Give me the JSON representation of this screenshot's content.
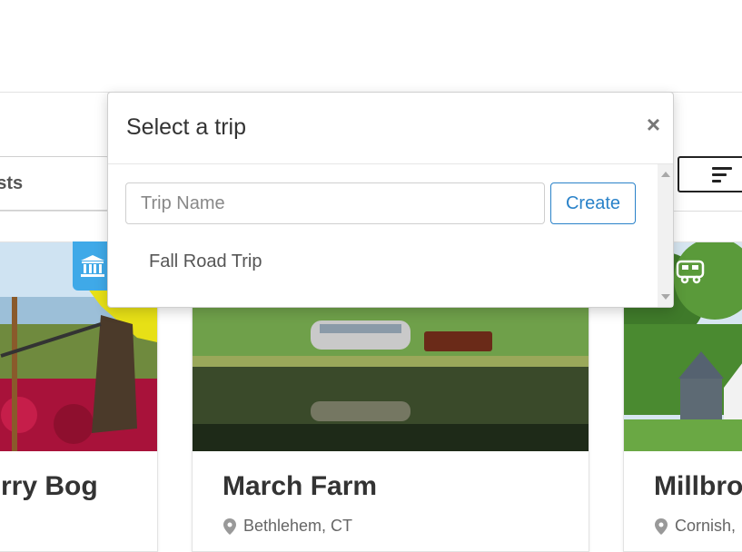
{
  "filter_bar": {
    "posts_tab_label": "osts",
    "sort_icon": "sort-lines-icon"
  },
  "cards": [
    {
      "title": "rry Bog",
      "location": "",
      "badge_icon": "museum-icon",
      "badge_color": "#3fa9e8"
    },
    {
      "title": "March Farm",
      "location": "Bethlehem, CT",
      "location_icon": "map-pin-icon"
    },
    {
      "title": "Millbro",
      "location": "Cornish,",
      "location_icon": "map-pin-icon",
      "badge_icon": "rv-icon"
    }
  ],
  "modal": {
    "title": "Select a trip",
    "close_label": "×",
    "trip_name_placeholder": "Trip Name",
    "trip_name_value": "",
    "create_label": "Create",
    "trips": [
      "Fall Road Trip"
    ],
    "accent_color": "#2a82c9"
  }
}
